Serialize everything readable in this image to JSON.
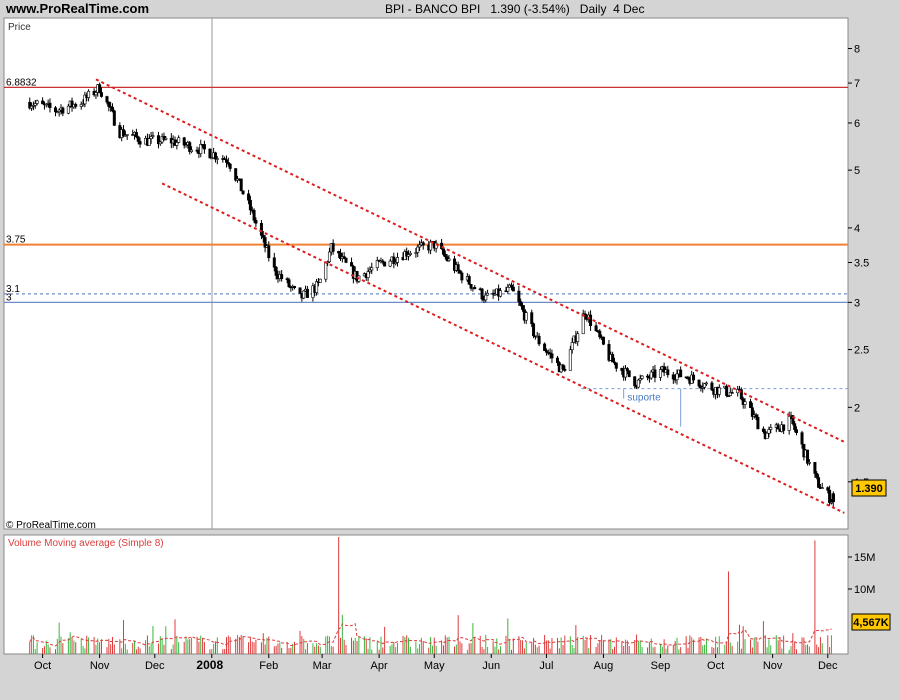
{
  "header": {
    "site": "www.ProRealTime.com",
    "instrument": "BPI - BANCO BPI",
    "last": "1.390 (-3.54%)",
    "period": "Daily",
    "date": "4 Dec"
  },
  "price_panel": {
    "label": "Price",
    "copyright": "© ProRealTime.com",
    "current_price_tag": "1.390",
    "annotation": "suporte",
    "levels": [
      {
        "label": "6.8832",
        "value": 6.8832,
        "color": "#c83232"
      },
      {
        "label": "3.75",
        "value": 3.75,
        "color": "#f08232"
      },
      {
        "label": "3.1",
        "value": 3.1,
        "color": "#6e8cc8"
      },
      {
        "label": "3",
        "value": 3.0,
        "color": "#6e8cc8"
      }
    ]
  },
  "volume_panel": {
    "label": "Volume Moving average (Simple 8)",
    "current_volume_tag": "4,567K",
    "yticks": [
      "15M",
      "10M"
    ]
  },
  "colors": {
    "background": "#ffffff",
    "frame": "#d4d4d4",
    "candle": "#000000",
    "channel": "#dc1e1e",
    "volume_up": "#3cb43c",
    "volume_down": "#dc3c3c",
    "volume_ma": "#dc3c3c",
    "tag_bg": "#ffc800"
  },
  "chart_data": [
    {
      "type": "candlestick",
      "title": "BPI - BANCO BPI",
      "ylabel": "Price",
      "yscale": "log",
      "ylim": [
        1.25,
        9.0
      ],
      "yticks": [
        1.5,
        2,
        2.5,
        3,
        3.5,
        4,
        5,
        6,
        7,
        8
      ],
      "xticks": [
        "Oct",
        "Nov",
        "Dec",
        "2008",
        "Feb",
        "Mar",
        "Apr",
        "May",
        "Jun",
        "Jul",
        "Aug",
        "Sep",
        "Oct",
        "Nov",
        "Dec"
      ],
      "series": [
        {
          "x": [
            "2007-09-24",
            "2007-10-08",
            "2007-10-22",
            "2007-11-01",
            "2007-11-12",
            "2007-11-26",
            "2007-12-10",
            "2007-12-28",
            "2008-01-10",
            "2008-01-22",
            "2008-02-04",
            "2008-02-18",
            "2008-02-28",
            "2008-03-06",
            "2008-03-20",
            "2008-04-03",
            "2008-04-17",
            "2008-05-01",
            "2008-05-15",
            "2008-05-29",
            "2008-06-12",
            "2008-06-26",
            "2008-07-10",
            "2008-07-22",
            "2008-08-05",
            "2008-08-19",
            "2008-09-02",
            "2008-09-16",
            "2008-09-30",
            "2008-10-14",
            "2008-10-28",
            "2008-11-11",
            "2008-11-25",
            "2008-12-04"
          ],
          "values": [
            6.5,
            6.3,
            6.5,
            6.88,
            5.8,
            5.6,
            5.6,
            5.4,
            5.2,
            4.3,
            3.4,
            3.05,
            3.2,
            3.7,
            3.3,
            3.5,
            3.65,
            3.75,
            3.35,
            3.05,
            3.15,
            2.6,
            2.3,
            2.9,
            2.4,
            2.2,
            2.3,
            2.25,
            2.15,
            2.1,
            1.8,
            1.9,
            1.5,
            1.39
          ]
        }
      ],
      "channel": {
        "upper": [
          {
            "x": "2007-10-30",
            "y": 7.1
          },
          {
            "x": "2008-12-10",
            "y": 1.75
          }
        ],
        "lower": [
          {
            "x": "2007-12-05",
            "y": 4.75
          },
          {
            "x": "2008-12-10",
            "y": 1.33
          }
        ]
      },
      "horizontal_lines": [
        6.8832,
        3.75,
        3.1,
        3.0
      ],
      "support": {
        "label": "suporte",
        "value": 2.15
      }
    },
    {
      "type": "bar",
      "title": "Volume Moving average (Simple 8)",
      "yticks": [
        "15M",
        "10M"
      ],
      "ylim": [
        0,
        17000000
      ],
      "series": [
        {
          "name": "Volume",
          "peaks": [
            {
              "x": "2007-10-27",
              "value": 12000000
            },
            {
              "x": "2008-03-10",
              "value": 17000000
            },
            {
              "x": "2008-10-08",
              "value": 12000000
            },
            {
              "x": "2008-11-24",
              "value": 16500000
            }
          ]
        },
        {
          "name": "Moving average (Simple 8)",
          "current": 4567000
        }
      ]
    }
  ]
}
